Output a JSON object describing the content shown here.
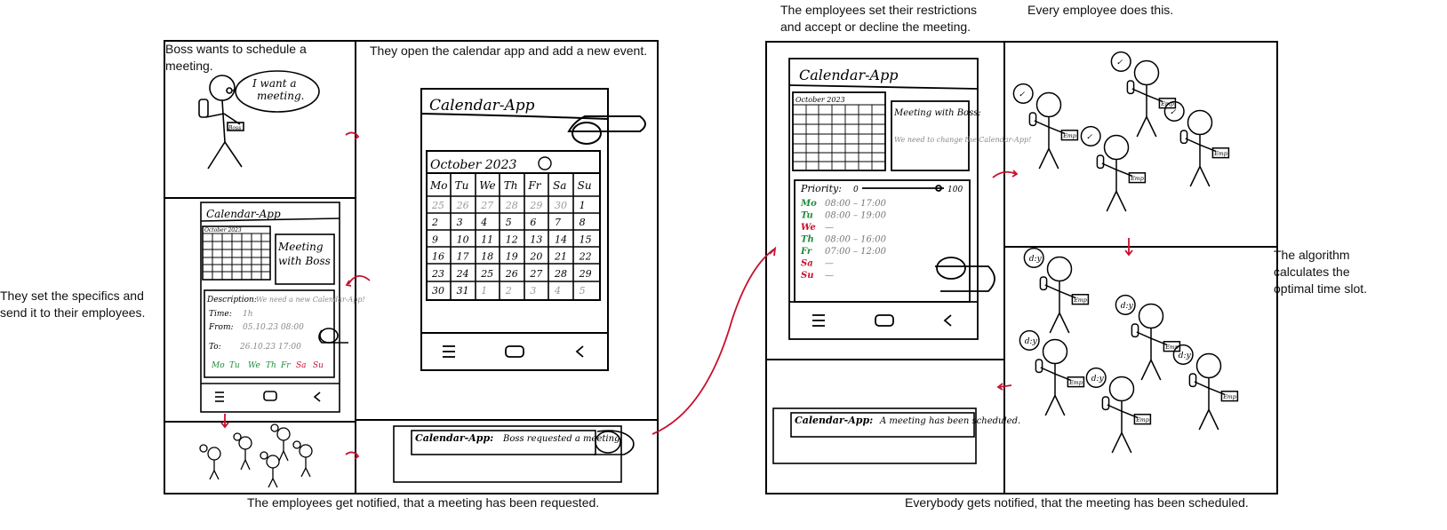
{
  "captions": {
    "boss_wants": "Boss wants to schedule a meeting.",
    "open_calendar": "They open the calendar app and add a new event.",
    "set_specifics": "They set the specifics and send it to their employees.",
    "employees_notified": "The employees get notified, that a meeting has been requested.",
    "employees_restrictions": "The employees set their restrictions and accept or decline the meeting.",
    "every_employee": "Every employee does this.",
    "algorithm": "The algorithm calculates the optimal time slot.",
    "everybody_notified": "Everybody gets notified, that the meeting has been scheduled."
  },
  "sketch": {
    "speech_bubble": "I want a meeting.",
    "boss_badge": "Boss",
    "emp_badge": "Emp",
    "app_title": "Calendar-App",
    "month": "October 2023",
    "weekdays": [
      "Mo",
      "Tu",
      "We",
      "Th",
      "Fr",
      "Sa",
      "Su"
    ],
    "calendar_days": [
      "25",
      "26",
      "27",
      "28",
      "29",
      "30",
      "1",
      "2",
      "3",
      "4",
      "5",
      "6",
      "7",
      "8",
      "9",
      "10",
      "11",
      "12",
      "13",
      "14",
      "15",
      "16",
      "17",
      "18",
      "19",
      "20",
      "21",
      "22",
      "23",
      "24",
      "25",
      "26",
      "27",
      "28",
      "29",
      "30",
      "31",
      "1",
      "2",
      "3",
      "4",
      "5"
    ],
    "meeting_box": "Meeting with Boss",
    "description_label": "Description:",
    "description_value": "We need a new Calendar-App!",
    "time_label": "Time:",
    "time_value": "1h",
    "from_label": "From:",
    "from_value": "05.10.23  08:00",
    "to_label": "To:",
    "to_value": "26.10.23  17:00",
    "notif_app": "Calendar-App:",
    "notif_requested": "Boss requested a meeting.",
    "notif_scheduled": "A meeting has been scheduled.",
    "meeting_with_boss_label": "Meeting with Boss:",
    "meeting_with_boss_desc": "We need to change the Calendar-App!",
    "priority_label": "Priority:",
    "priority_min": "0",
    "priority_max": "100",
    "availability": [
      {
        "day": "Mo",
        "time": "08:00 – 17:00"
      },
      {
        "day": "Tu",
        "time": "08:00 – 19:00"
      },
      {
        "day": "We",
        "time": "—"
      },
      {
        "day": "Th",
        "time": "08:00 – 16:00"
      },
      {
        "day": "Fr",
        "time": "07:00 – 12:00"
      },
      {
        "day": "Sa",
        "time": "—"
      },
      {
        "day": "Su",
        "time": "—"
      }
    ],
    "check_mark": "✓",
    "bubble_dizzy": "d:y"
  }
}
